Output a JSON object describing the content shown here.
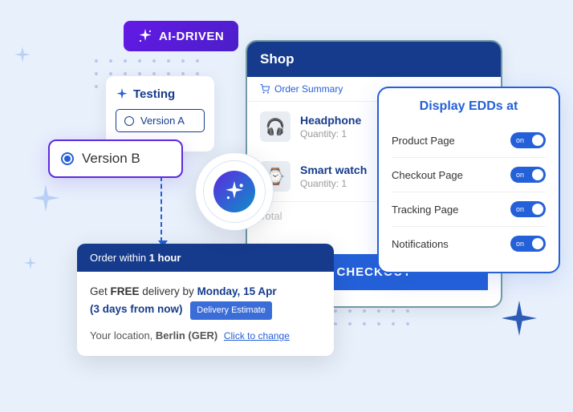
{
  "ai_badge": "AI-DRIVEN",
  "testing": {
    "title": "Testing",
    "version_a": "Version A",
    "version_b": "Version B"
  },
  "shop": {
    "title": "Shop",
    "summary_label": "Order Summary",
    "items": [
      {
        "name": "Headphone",
        "qty": "Quantity: 1",
        "icon": "🎧"
      },
      {
        "name": "Smart watch",
        "qty": "Quantity: 1",
        "icon": "⌚"
      }
    ],
    "total_label": "Total",
    "checkout": "CHECKOUT"
  },
  "delivery": {
    "header_prefix": "Order within ",
    "header_bold": "1 hour",
    "line1_prefix": "Get ",
    "line1_free": "FREE",
    "line1_mid": " delivery by ",
    "line1_date": "Monday, 15 Apr",
    "line2_paren": "(3 days from now)",
    "estimate_badge": "Delivery Estimate",
    "loc_prefix": "Your location, ",
    "loc_value": "Berlin (GER)",
    "change": "Click to change"
  },
  "edd": {
    "title": "Display EDDs at",
    "rows": [
      {
        "label": "Product Page",
        "state": "on"
      },
      {
        "label": "Checkout Page",
        "state": "on"
      },
      {
        "label": "Tracking Page",
        "state": "on"
      },
      {
        "label": "Notifications",
        "state": "on"
      }
    ]
  }
}
